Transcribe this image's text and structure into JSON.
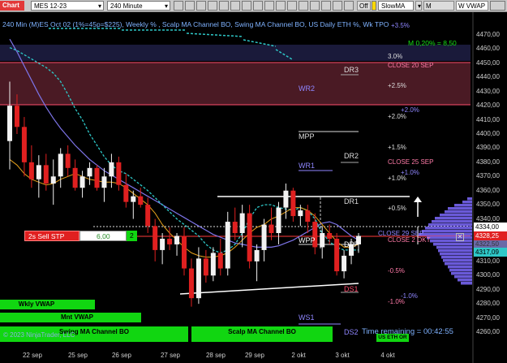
{
  "toolbar": {
    "app_label": "Chart",
    "instrument": "MES 12-23",
    "timeframe": "240 Minute",
    "plot_off": "Off",
    "indicator_dropdown": "SlowMA",
    "btn_mvwap": "M VWAP",
    "btn_wvwap": "W VWAP"
  },
  "header": {
    "title": "240 Min (M)ES Oct 02 (1%=45p=$225), Weekly % , Scalp MA Channel BO, Swing MA Channel BO, US Daily ETH %, Wk TPO",
    "slow_ma_readout": "M 0,20% = 8,50"
  },
  "levels": {
    "pct_3_5": "+3.5%",
    "pct_3_0": "3.0%",
    "close_20_sep": "CLOSE 20 SEP",
    "dr3": "DR3",
    "wr2": "WR2",
    "pct_2_5": "+2.5%",
    "pct_2_0_a": "+2.0%",
    "pct_2_0_b": "+2.0%",
    "mpp": "MPP",
    "pct_1_5": "+1.5%",
    "dr2": "DR2",
    "close_25_sep": "CLOSE 25 SEP",
    "wr1": "WR1",
    "pct_1_0_a": "+1.0%",
    "pct_1_0_b": "+1.0%",
    "dr1": "DR1",
    "pct_0_5": "+0.5%",
    "close_29_sep": "CLOSE 29 SEP",
    "close_2_okt": "CLOSE 2 OKT",
    "wpp": "WPP",
    "dpp": "DPP",
    "pct_m0_5": "-0.5%",
    "ds1": "DS1",
    "pct_m1_0_a": "-1.0%",
    "pct_m1_0_b": "-1.0%",
    "ws1": "WS1",
    "ds2": "DS2"
  },
  "order": {
    "sell_stp_label": "2s  Sell STP",
    "price": "6,00",
    "qty": "2"
  },
  "price_tags": {
    "last": "4334,00",
    "current": "4328,25",
    "current_hidden": "4322,50",
    "ma": "4317,09"
  },
  "y_axis": [
    "4470,00",
    "4460,00",
    "4450,00",
    "4440,00",
    "4430,00",
    "4420,00",
    "4410,00",
    "4400,00",
    "4390,00",
    "4380,00",
    "4370,00",
    "4360,00",
    "4350,00",
    "4340,00",
    "4330,00",
    "4320,00",
    "4310,00",
    "4300,00",
    "4290,00",
    "4280,00",
    "4270,00",
    "4260,00"
  ],
  "x_axis": [
    "22 sep",
    "25 sep",
    "26 sep",
    "27 sep",
    "28 sep",
    "29 sep",
    "2 okt",
    "3 okt",
    "4 okt"
  ],
  "bottom": {
    "wkly_vwap": "Wkly VWAP",
    "mnt_vwap": "Mnt VWAP",
    "swing_bo": "Swing MA Channel BO",
    "scalp_bo": "Scalp MA Channel BO",
    "us_eth_or": "US ETH OR",
    "copyright": "© 2023 NinjaTrader, LLC",
    "time_remaining": "Time remaining = 00:42:55"
  },
  "colors": {
    "bull": "#f2f2f2",
    "bear": "#e02020",
    "purple_ma": "#7d74e8",
    "orange_ma": "#e7a21c",
    "cyan_ma": "#2ec8c8",
    "green": "#11d611",
    "level_purple": "#8f86ff",
    "level_red": "#ff7aa8"
  },
  "candles": [
    {
      "o": 4395,
      "h": 4437,
      "l": 4375,
      "c": 4420
    },
    {
      "o": 4420,
      "h": 4428,
      "l": 4400,
      "c": 4405
    },
    {
      "o": 4405,
      "h": 4412,
      "l": 4370,
      "c": 4380
    },
    {
      "o": 4380,
      "h": 4392,
      "l": 4362,
      "c": 4368
    },
    {
      "o": 4368,
      "h": 4385,
      "l": 4355,
      "c": 4378
    },
    {
      "o": 4378,
      "h": 4386,
      "l": 4360,
      "c": 4365
    },
    {
      "o": 4365,
      "h": 4382,
      "l": 4350,
      "c": 4370
    },
    {
      "o": 4370,
      "h": 4390,
      "l": 4362,
      "c": 4386
    },
    {
      "o": 4386,
      "h": 4392,
      "l": 4370,
      "c": 4376
    },
    {
      "o": 4376,
      "h": 4382,
      "l": 4360,
      "c": 4362
    },
    {
      "o": 4362,
      "h": 4374,
      "l": 4355,
      "c": 4370
    },
    {
      "o": 4370,
      "h": 4380,
      "l": 4364,
      "c": 4376
    },
    {
      "o": 4376,
      "h": 4378,
      "l": 4360,
      "c": 4362
    },
    {
      "o": 4362,
      "h": 4376,
      "l": 4352,
      "c": 4370
    },
    {
      "o": 4370,
      "h": 4386,
      "l": 4362,
      "c": 4380
    },
    {
      "o": 4380,
      "h": 4384,
      "l": 4360,
      "c": 4364
    },
    {
      "o": 4364,
      "h": 4372,
      "l": 4348,
      "c": 4352
    },
    {
      "o": 4352,
      "h": 4360,
      "l": 4340,
      "c": 4356
    },
    {
      "o": 4356,
      "h": 4362,
      "l": 4348,
      "c": 4350
    },
    {
      "o": 4350,
      "h": 4355,
      "l": 4330,
      "c": 4335
    },
    {
      "o": 4335,
      "h": 4340,
      "l": 4310,
      "c": 4318
    },
    {
      "o": 4318,
      "h": 4330,
      "l": 4308,
      "c": 4326
    },
    {
      "o": 4326,
      "h": 4334,
      "l": 4318,
      "c": 4322
    },
    {
      "o": 4322,
      "h": 4330,
      "l": 4314,
      "c": 4328
    },
    {
      "o": 4328,
      "h": 4334,
      "l": 4300,
      "c": 4305
    },
    {
      "o": 4305,
      "h": 4312,
      "l": 4278,
      "c": 4284
    },
    {
      "o": 4284,
      "h": 4320,
      "l": 4280,
      "c": 4312
    },
    {
      "o": 4312,
      "h": 4318,
      "l": 4295,
      "c": 4300
    },
    {
      "o": 4300,
      "h": 4320,
      "l": 4296,
      "c": 4316
    },
    {
      "o": 4316,
      "h": 4326,
      "l": 4300,
      "c": 4305
    },
    {
      "o": 4305,
      "h": 4345,
      "l": 4300,
      "c": 4338
    },
    {
      "o": 4338,
      "h": 4348,
      "l": 4325,
      "c": 4330
    },
    {
      "o": 4330,
      "h": 4350,
      "l": 4320,
      "c": 4344
    },
    {
      "o": 4344,
      "h": 4350,
      "l": 4305,
      "c": 4310
    },
    {
      "o": 4310,
      "h": 4322,
      "l": 4296,
      "c": 4318
    },
    {
      "o": 4318,
      "h": 4340,
      "l": 4310,
      "c": 4336
    },
    {
      "o": 4336,
      "h": 4348,
      "l": 4325,
      "c": 4330
    },
    {
      "o": 4330,
      "h": 4352,
      "l": 4322,
      "c": 4348
    },
    {
      "o": 4348,
      "h": 4365,
      "l": 4340,
      "c": 4360
    },
    {
      "o": 4360,
      "h": 4362,
      "l": 4338,
      "c": 4342
    },
    {
      "o": 4342,
      "h": 4350,
      "l": 4335,
      "c": 4346
    },
    {
      "o": 4346,
      "h": 4350,
      "l": 4330,
      "c": 4338
    },
    {
      "o": 4338,
      "h": 4344,
      "l": 4315,
      "c": 4320
    },
    {
      "o": 4320,
      "h": 4335,
      "l": 4312,
      "c": 4330
    },
    {
      "o": 4330,
      "h": 4336,
      "l": 4322,
      "c": 4326
    },
    {
      "o": 4326,
      "h": 4330,
      "l": 4300,
      "c": 4303
    },
    {
      "o": 4303,
      "h": 4318,
      "l": 4298,
      "c": 4314
    },
    {
      "o": 4314,
      "h": 4326,
      "l": 4308,
      "c": 4322
    },
    {
      "o": 4322,
      "h": 4330,
      "l": 4316,
      "c": 4328
    }
  ],
  "ma_slow": [
    4467,
    4458,
    4448,
    4438,
    4428,
    4419,
    4411,
    4404,
    4398,
    4392,
    4387,
    4382,
    4378,
    4374,
    4371,
    4368,
    4365,
    4362,
    4359,
    4356,
    4353,
    4350,
    4347,
    4344,
    4341,
    4338,
    4335,
    4332,
    4329,
    4327,
    4325,
    4323,
    4322,
    4321,
    4320,
    4320,
    4320,
    4321,
    4323,
    4325,
    4328,
    4331,
    4334,
    4337,
    4338,
    4336,
    4332,
    4328,
    4325
  ],
  "ma_fast": [
    4382,
    4378,
    4372,
    4368,
    4366,
    4364,
    4365,
    4368,
    4370,
    4372,
    4370,
    4368,
    4367,
    4366,
    4366,
    4365,
    4362,
    4358,
    4354,
    4350,
    4344,
    4336,
    4330,
    4325,
    4320,
    4316,
    4314,
    4313,
    4313,
    4314,
    4316,
    4320,
    4325,
    4330,
    4334,
    4336,
    4340,
    4342,
    4345,
    4348,
    4348,
    4346,
    4342,
    4336,
    4330,
    4324,
    4320,
    4320,
    4322
  ],
  "ma_cyan": [
    4461,
    4459,
    4456,
    4453,
    4450,
    4447,
    4443,
    4437,
    4428,
    4418,
    4410,
    4400,
    4392,
    4384,
    4378,
    4374,
    4372,
    4368,
    4364,
    4360,
    4355,
    4350,
    4345,
    4340,
    4336,
    4332,
    4328,
    4322,
    4318,
    4316,
    4318,
    4322,
    4330,
    4340,
    4348,
    4350,
    4350,
    4348,
    4347,
    4346,
    4348,
    4346,
    4340,
    4330,
    4324,
    4320,
    4318,
    4318,
    4318
  ]
}
